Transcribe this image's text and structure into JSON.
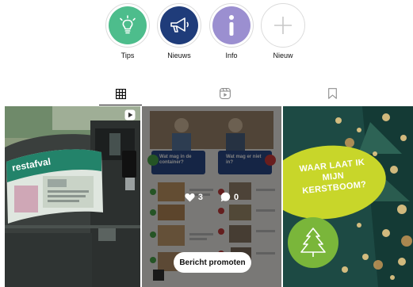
{
  "highlights": [
    {
      "label": "Tips",
      "icon": "lightbulb-icon",
      "color": "#4dbd8c"
    },
    {
      "label": "Nieuws",
      "icon": "megaphone-icon",
      "color": "#1f3c7a"
    },
    {
      "label": "Info",
      "icon": "info-icon",
      "color": "#9b8fd0"
    },
    {
      "label": "Nieuw",
      "icon": "plus-icon",
      "color": "#ffffff"
    }
  ],
  "tabs": [
    {
      "name": "posts",
      "icon": "grid-icon",
      "active": true
    },
    {
      "name": "reels",
      "icon": "reels-icon",
      "active": false
    },
    {
      "name": "saved",
      "icon": "bookmark-icon",
      "active": false
    }
  ],
  "posts": {
    "post1": {
      "sign_text": "restafval",
      "badge_icon": "reel-play-icon"
    },
    "post2": {
      "likes": "3",
      "comments": "0",
      "promote_label": "Bericht promoten",
      "bubble_left": "Wat mag in de container?",
      "bubble_right": "Wat mag er niet in?"
    },
    "post3": {
      "headline": "Waar laat ik mijn kerstboom?",
      "icon": "tree-icon"
    }
  }
}
